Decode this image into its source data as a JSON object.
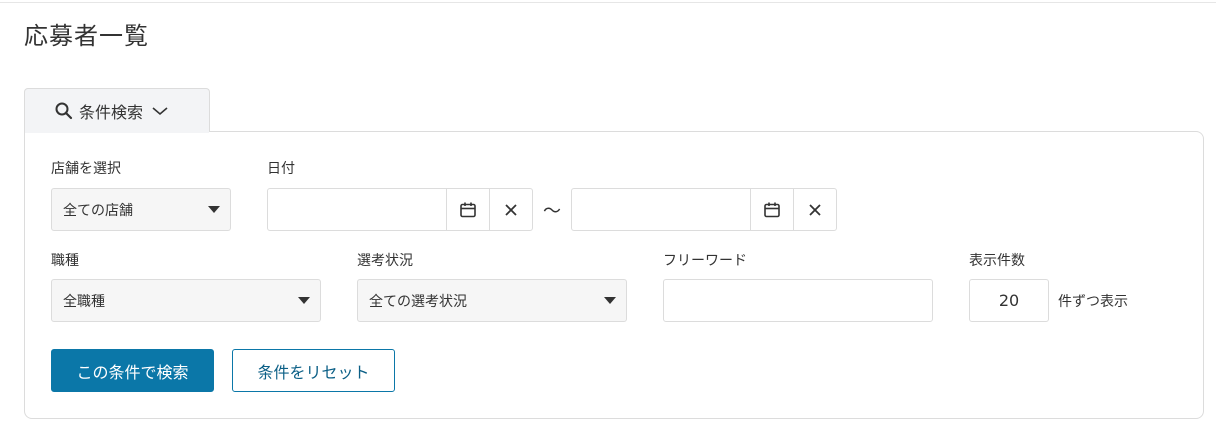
{
  "page": {
    "title": "応募者一覧"
  },
  "search_tab": {
    "label": "条件検索",
    "icons": [
      "search-icon",
      "chevron-down-icon"
    ]
  },
  "filters": {
    "store": {
      "label": "店舗を選択",
      "value": "全ての店舗"
    },
    "date": {
      "label": "日付",
      "from_value": "",
      "to_value": "",
      "separator": "〜",
      "icons": [
        "calendar-icon",
        "close-icon"
      ]
    },
    "job_type": {
      "label": "職種",
      "value": "全職種"
    },
    "status": {
      "label": "選考状況",
      "value": "全ての選考状況"
    },
    "freeword": {
      "label": "フリーワード",
      "value": ""
    },
    "page_size": {
      "label": "表示件数",
      "value": "20",
      "suffix": "件ずつ表示"
    }
  },
  "actions": {
    "search_label": "この条件で検索",
    "reset_label": "条件をリセット"
  },
  "colors": {
    "primary": "#0b77a8",
    "border": "#dcdcdc",
    "tab_bg": "#f3f4f6"
  }
}
